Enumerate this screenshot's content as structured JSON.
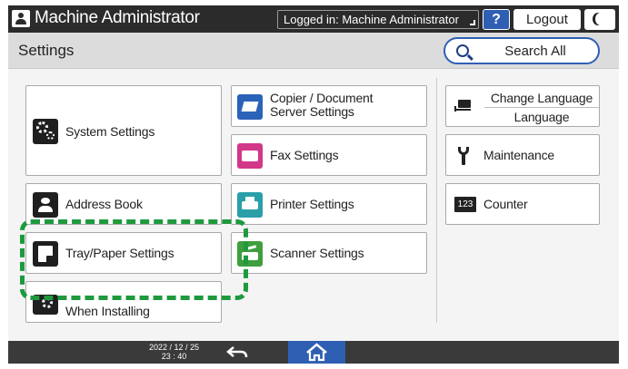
{
  "topbar": {
    "admin_title": "Machine Administrator",
    "login_status": "Logged in: Machine Administrator",
    "help_label": "?",
    "logout_label": "Logout"
  },
  "header": {
    "title": "Settings",
    "search_label": "Search All"
  },
  "tiles": {
    "system_settings": "System Settings",
    "address_book": "Address Book",
    "tray_paper": "Tray/Paper Settings",
    "when_installing": "When Installing",
    "copier_line1": "Copier / Document",
    "copier_line2": "Server Settings",
    "fax": "Fax Settings",
    "printer": "Printer Settings",
    "scanner": "Scanner Settings",
    "change_language_top": "Change Language",
    "change_language_bottom": "Language",
    "maintenance": "Maintenance",
    "counter": "Counter",
    "counter_icon_text": "123"
  },
  "bottombar": {
    "date": "2022 / 12 / 25",
    "time": "23 : 40"
  },
  "colors": {
    "accent_blue": "#2f5fb3",
    "highlight_green": "#1e9a3e",
    "topbar_bg": "#2b2b2b"
  }
}
